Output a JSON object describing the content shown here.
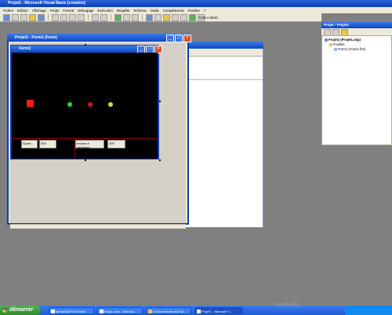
{
  "app": {
    "title": "Projet1 - Microsoft Visual Basic [création]",
    "menu": [
      "Fichier",
      "Edition",
      "Affichage",
      "Projet",
      "Format",
      "Débogage",
      "Exécution",
      "Requête",
      "Schéma",
      "Outils",
      "Compléments",
      "Fenêtre",
      "?"
    ],
    "coords": "7215 x 5640"
  },
  "project_window": {
    "title": "Projet1 - Form1 (Form)"
  },
  "form_window": {
    "title": "Form1",
    "score_label": "Score :",
    "score_value": "300",
    "remaining_label": "encore à ramasser",
    "remaining_value": "300",
    "colors": {
      "paddle": "#ff1a1a",
      "ball_green": "#22dd22",
      "ball_red": "#dd1111",
      "ball_yellow": "#e5d820"
    }
  },
  "project_explorer": {
    "title": "Projet - Projet1",
    "tree": [
      "Projet1 (Projet1.vbp)",
      "Feuilles",
      "Form1 (Form1.frm)"
    ]
  },
  "taskbar": {
    "start": "démarrer",
    "items": [
      "sam@Dlt270 Defekte",
      "chap1.docx - Microso...",
      "C:\\Documents and Se...",
      "Projet1 - Microsoft V..."
    ]
  },
  "watermark": "Sarah Etr..."
}
